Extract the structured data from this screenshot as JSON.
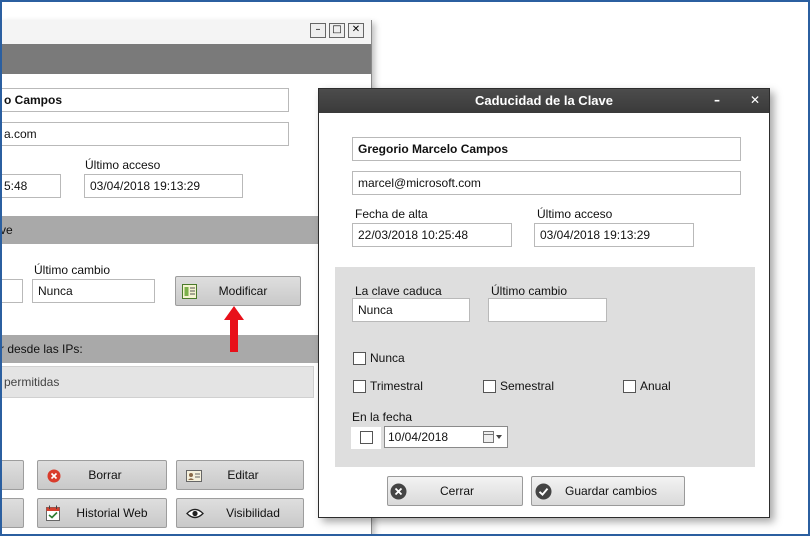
{
  "back_window": {
    "name_value": "o Campos",
    "email_value": "a.com",
    "time_value": "5:48",
    "last_access_label": "Último acceso",
    "last_access_value": "03/04/2018 19:13:29",
    "band_password": "ve",
    "last_change_label": "Último cambio",
    "last_change_value": "Nunca",
    "modify_label": "Modificar",
    "band_ips": "r desde las IPs:",
    "ips_value": "permitidas",
    "delete_label": "Borrar",
    "edit_label": "Editar",
    "web_history_label": "Historial Web",
    "visibility_label": "Visibilidad"
  },
  "dialog": {
    "title": "Caducidad de la Clave",
    "name_value": "Gregorio Marcelo Campos",
    "email_value": "marcel@microsoft.com",
    "signup_label": "Fecha de alta",
    "signup_value": "22/03/2018 10:25:48",
    "last_access_label": "Último acceso",
    "last_access_value": "03/04/2018 19:13:29",
    "expires_label": "La clave caduca",
    "expires_value": "Nunca",
    "last_change_label": "Último cambio",
    "last_change_value": "",
    "opt_never": "Nunca",
    "opt_quarterly": "Trimestral",
    "opt_biannual": "Semestral",
    "opt_annual": "Anual",
    "on_date_label": "En la fecha",
    "date_value": "10/04/2018",
    "close_label": "Cerrar",
    "save_label": "Guardar cambios"
  },
  "colors": {
    "arrow": "#e8101a",
    "title_bar": "#3f3f3f",
    "group_bg": "#dedede",
    "band": "#a9a9a9"
  }
}
